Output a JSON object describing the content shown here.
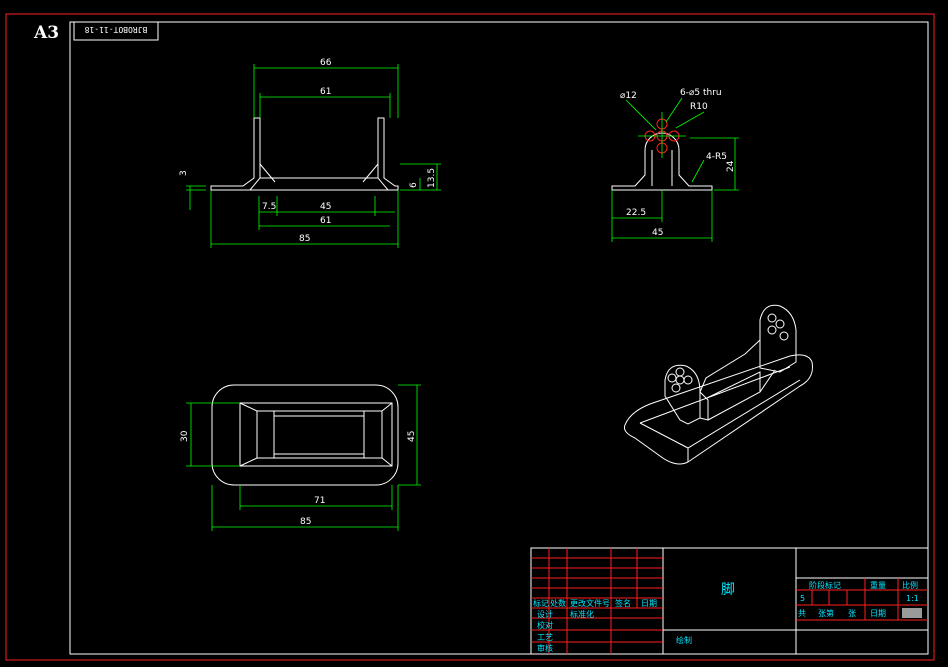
{
  "sheet": {
    "size_label": "A3",
    "drawing_code": "BJROBOT-11-18",
    "colors": {
      "background": "#000000",
      "outline": "#ffffff",
      "dimension": "#00ff00",
      "title_block_grid": "#ff2020",
      "title_text": "#00e5ff"
    }
  },
  "front_view": {
    "dims": {
      "outer_width": "66",
      "inner_width": "61",
      "plate_thickness": "3",
      "lip_height": "6",
      "total_height": "13.5",
      "left_offset": "7.5",
      "slot_width": "45",
      "slot_span": "61",
      "base_length": "85"
    }
  },
  "side_view": {
    "dims": {
      "hole_dia": "⌀12",
      "hole_callout": "6-⌀5 thru",
      "arc_radius": "R10",
      "corner_radius": "4-R5",
      "height": "24",
      "half_width": "22.5",
      "full_width": "45"
    }
  },
  "top_view": {
    "dims": {
      "inner_height": "30",
      "outer_height": "45",
      "inner_length": "71",
      "outer_length": "85"
    }
  },
  "title_block": {
    "part_name": "脚",
    "cols_header": [
      "阶段标记",
      "重量",
      "比例"
    ],
    "weight_value": "5",
    "scale": "1:1",
    "sheet_row": [
      "共",
      "张第",
      "张",
      "日期"
    ],
    "row_labels": [
      "设计",
      "校对",
      "工艺",
      "审核"
    ],
    "sign_label": "标准化",
    "drawn_label": "绘制",
    "small_headers": [
      "标记",
      "处数",
      "更改文件号",
      "签名",
      "日期"
    ]
  }
}
